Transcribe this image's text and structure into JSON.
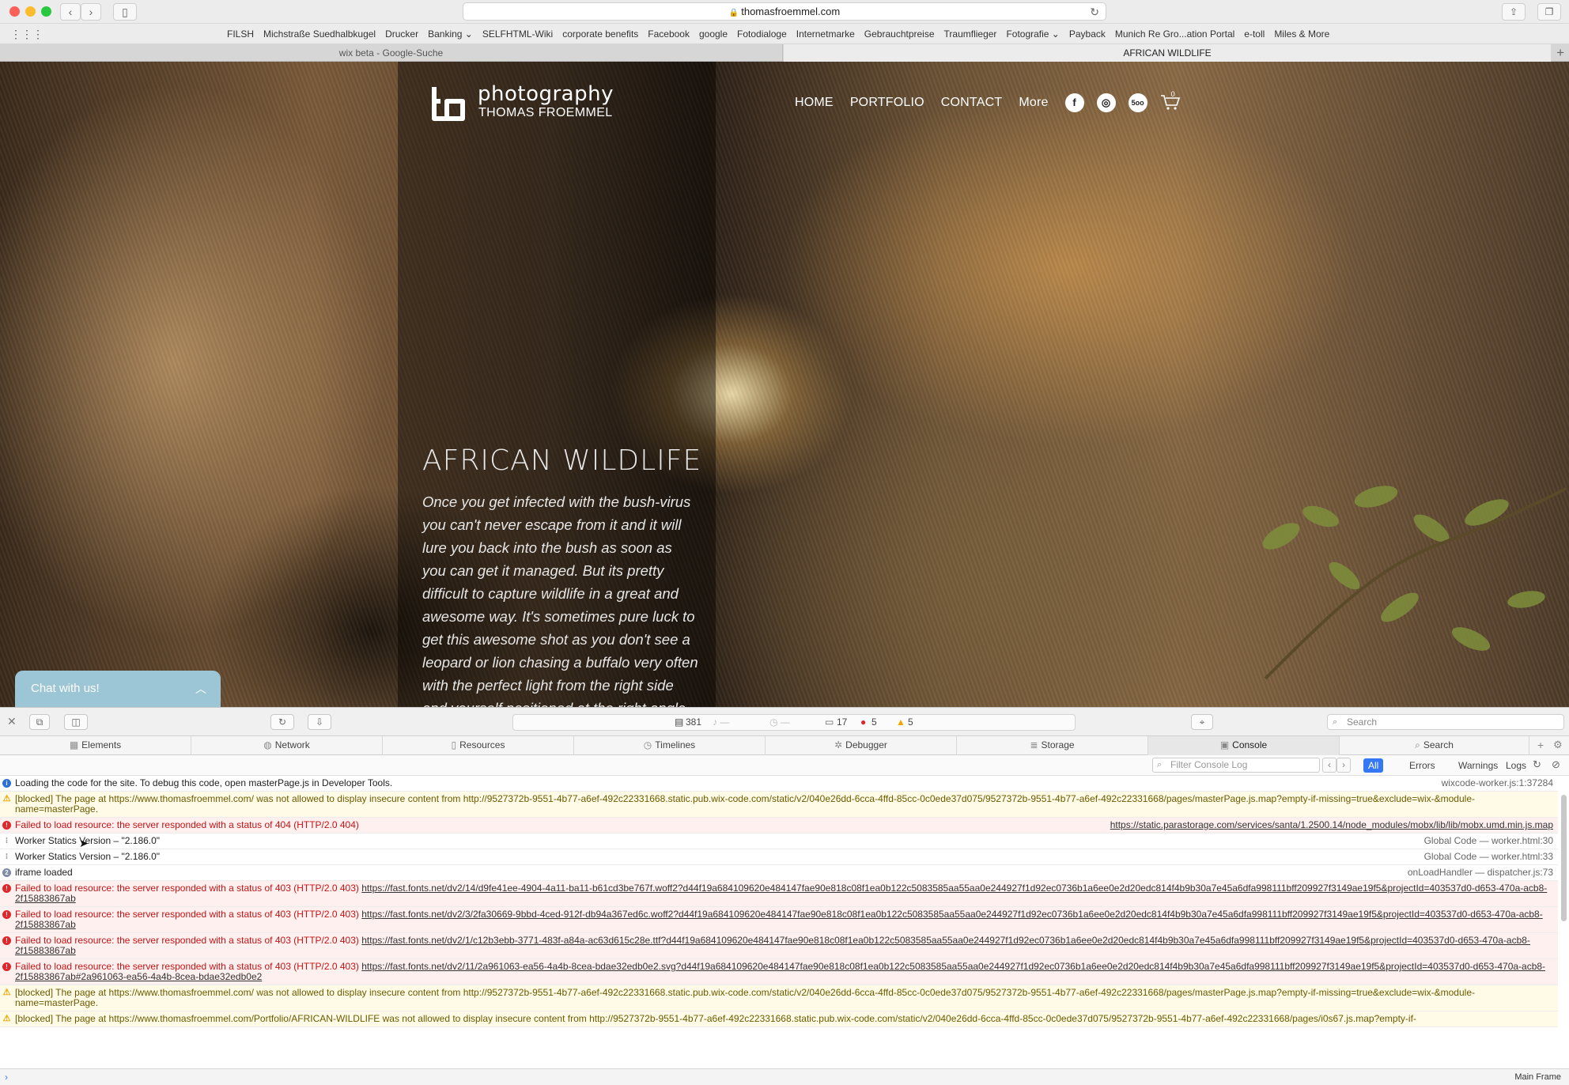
{
  "browser": {
    "url": "thomasfroemmel.com",
    "bookmarks": [
      "FILSH",
      "Michstraße Suedhalbkugel",
      "Drucker",
      "Banking ⌄",
      "SELFHTML-Wiki",
      "corporate benefits",
      "Facebook",
      "google",
      "Fotodialoge",
      "Internetmarke",
      "Gebrauchtpreise",
      "Traumflieger",
      "Fotografie ⌄",
      "Payback",
      "Munich Re Gro...ation Portal",
      "e-toll",
      "Miles & More"
    ],
    "tabs": [
      "wix beta - Google-Suche",
      "AFRICAN WILDLIFE"
    ]
  },
  "site": {
    "logo_title": "photography",
    "logo_subtitle": "THOMAS FROEMMEL",
    "nav": [
      "HOME",
      "PORTFOLIO",
      "CONTACT",
      "More"
    ],
    "cart_count": "0",
    "hero_title": "AFRICAN WILDLIFE",
    "hero_text": "Once you get infected with the bush-virus you can't never escape from it and it will lure you back into the bush as soon as you can get it managed. But its pretty difficult to capture wildlife in a great and awesome way. It's sometimes pure luck to get this awesome shot as you don't see a leopard or lion chasing a buffalo very often with the perfect light from the right side and yourself positioned at the right angle with no bush or",
    "chat_label": "Chat with us!"
  },
  "devtools": {
    "status": {
      "resources": "381",
      "messages": "17",
      "errors": "5",
      "warnings": "5"
    },
    "search_placeholder": "Search",
    "tabs": [
      "Elements",
      "Network",
      "Resources",
      "Timelines",
      "Debugger",
      "Storage",
      "Console",
      "Search"
    ],
    "filter_placeholder": "Filter Console Log",
    "filters": [
      "All",
      "Errors",
      "Warnings",
      "Logs"
    ],
    "main_frame": "Main Frame",
    "console": [
      {
        "type": "info",
        "text": "Loading the code for the site. To debug this code, open masterPage.js in Developer Tools.",
        "source": "wixcode-worker.js:1:37284"
      },
      {
        "type": "warn",
        "text": "[blocked] The page at https://www.thomasfroemmel.com/ was not allowed to display insecure content from http://9527372b-9551-4b77-a6ef-492c22331668.static.pub.wix-code.com/static/v2/040e26dd-6cca-4ffd-85cc-0c0ede37d075/9527372b-9551-4b77-a6ef-492c22331668/pages/masterPage.js.map?empty-if-missing=true&exclude=wix-&module-name=masterPage.",
        "source": ""
      },
      {
        "type": "err",
        "text": "Failed to load resource: the server responded with a status of 404 (HTTP/2.0 404)",
        "source": "https://static.parastorage.com/services/santa/1.2500.14/node_modules/mobx/lib/lib/mobx.umd.min.js.map"
      },
      {
        "type": "log",
        "text": "Worker Statics Version – \"2.186.0\"",
        "source": "Global Code — worker.html:30"
      },
      {
        "type": "log",
        "text": "Worker Statics Version – \"2.186.0\"",
        "source": "Global Code — worker.html:33"
      },
      {
        "type": "num",
        "text": "iframe loaded",
        "source": "onLoadHandler — dispatcher.js:73"
      },
      {
        "type": "err",
        "text": "Failed to load resource: the server responded with a status of 403 (HTTP/2.0 403)",
        "url": "https://fast.fonts.net/dv2/14/d9fe41ee-4904-4a11-ba11-b61cd3be767f.woff2?d44f19a684109620e484147fae90e818c08f1ea0b122c5083585aa55aa0e244927f1d92ec0736b1a6ee0e2d20edc814f4b9b30a7e45a6dfa998111bff209927f3149ae19f5&projectId=403537d0-d653-470a-acb8-2f15883867ab"
      },
      {
        "type": "err",
        "text": "Failed to load resource: the server responded with a status of 403 (HTTP/2.0 403)",
        "url": "https://fast.fonts.net/dv2/3/2fa30669-9bbd-4ced-912f-db94a367ed6c.woff2?d44f19a684109620e484147fae90e818c08f1ea0b122c5083585aa55aa0e244927f1d92ec0736b1a6ee0e2d20edc814f4b9b30a7e45a6dfa998111bff209927f3149ae19f5&projectId=403537d0-d653-470a-acb8-2f15883867ab"
      },
      {
        "type": "err",
        "text": "Failed to load resource: the server responded with a status of 403 (HTTP/2.0 403)",
        "url": "https://fast.fonts.net/dv2/1/c12b3ebb-3771-483f-a84a-ac63d615c28e.ttf?d44f19a684109620e484147fae90e818c08f1ea0b122c5083585aa55aa0e244927f1d92ec0736b1a6ee0e2d20edc814f4b9b30a7e45a6dfa998111bff209927f3149ae19f5&projectId=403537d0-d653-470a-acb8-2f15883867ab"
      },
      {
        "type": "err",
        "text": "Failed to load resource: the server responded with a status of 403 (HTTP/2.0 403)",
        "url": "https://fast.fonts.net/dv2/11/2a961063-ea56-4a4b-8cea-bdae32edb0e2.svg?d44f19a684109620e484147fae90e818c08f1ea0b122c5083585aa55aa0e244927f1d92ec0736b1a6ee0e2d20edc814f4b9b30a7e45a6dfa998111bff209927f3149ae19f5&projectId=403537d0-d653-470a-acb8-2f15883867ab#2a961063-ea56-4a4b-8cea-bdae32edb0e2"
      },
      {
        "type": "warn",
        "text": "[blocked] The page at https://www.thomasfroemmel.com/ was not allowed to display insecure content from http://9527372b-9551-4b77-a6ef-492c22331668.static.pub.wix-code.com/static/v2/040e26dd-6cca-4ffd-85cc-0c0ede37d075/9527372b-9551-4b77-a6ef-492c22331668/pages/masterPage.js.map?empty-if-missing=true&exclude=wix-&module-name=masterPage.",
        "source": ""
      },
      {
        "type": "warn",
        "text": "[blocked] The page at https://www.thomasfroemmel.com/Portfolio/AFRICAN-WILDLIFE was not allowed to display insecure content from http://9527372b-9551-4b77-a6ef-492c22331668.static.pub.wix-code.com/static/v2/040e26dd-6cca-4ffd-85cc-0c0ede37d075/9527372b-9551-4b77-a6ef-492c22331668/pages/i0s67.js.map?empty-if-",
        "source": ""
      }
    ]
  }
}
